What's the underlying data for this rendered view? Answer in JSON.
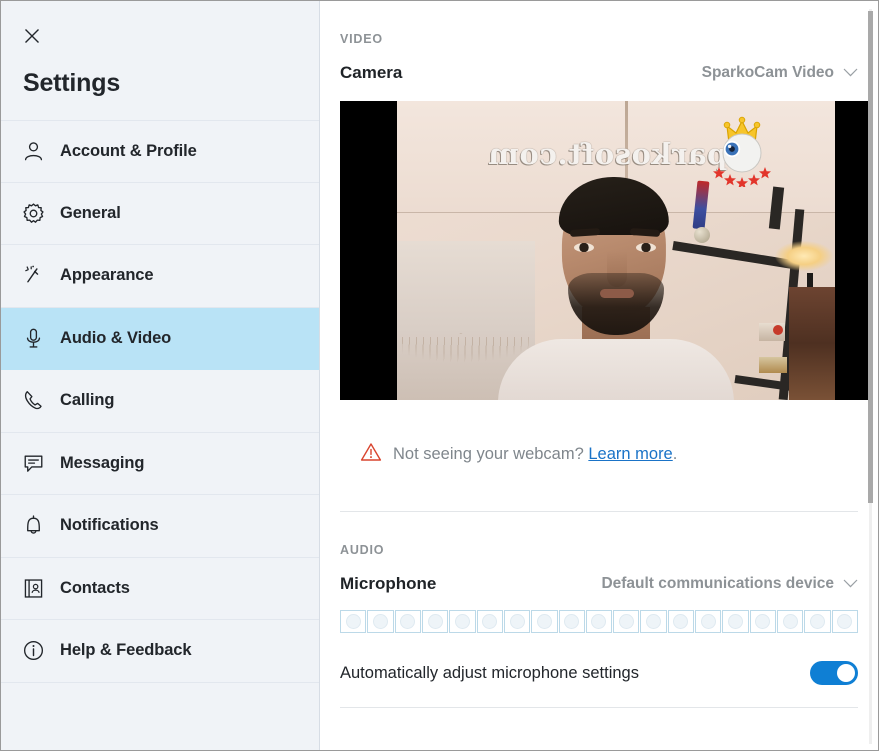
{
  "window": {
    "close_icon": "close-icon"
  },
  "sidebar": {
    "title": "Settings",
    "items": [
      {
        "label": "Account & Profile",
        "icon": "person-icon",
        "active": false
      },
      {
        "label": "General",
        "icon": "gear-icon",
        "active": false
      },
      {
        "label": "Appearance",
        "icon": "magic-wand-icon",
        "active": false
      },
      {
        "label": "Audio & Video",
        "icon": "microphone-icon",
        "active": true
      },
      {
        "label": "Calling",
        "icon": "phone-icon",
        "active": false
      },
      {
        "label": "Messaging",
        "icon": "chat-bubble-icon",
        "active": false
      },
      {
        "label": "Notifications",
        "icon": "bell-icon",
        "active": false
      },
      {
        "label": "Contacts",
        "icon": "address-book-icon",
        "active": false
      },
      {
        "label": "Help & Feedback",
        "icon": "info-circle-icon",
        "active": false
      }
    ]
  },
  "main": {
    "video": {
      "section_label": "VIDEO",
      "camera_label": "Camera",
      "camera_value": "SparkoCam Video",
      "chevron_icon": "chevron-down-icon",
      "preview": {
        "watermark": "sparkosoft.com",
        "overlay_icon": "crowned-eyeball-emoji"
      },
      "warning_icon": "warning-triangle-icon",
      "warning_text": "Not seeing your webcam?",
      "warning_link": "Learn more",
      "warning_suffix": "."
    },
    "audio": {
      "section_label": "AUDIO",
      "microphone_label": "Microphone",
      "microphone_value": "Default communications device",
      "chevron_icon": "chevron-down-icon",
      "meter_segments": 19,
      "auto_adjust_label": "Automatically adjust microphone settings",
      "auto_adjust_on": true
    }
  },
  "colors": {
    "accent_blue": "#0f7fd4",
    "selected_item_bg": "#b9e3f6",
    "sidebar_bg": "#f0f3f7",
    "link_blue": "#1a73c7",
    "warning_red": "#d9452f",
    "muted_text": "#8d9296"
  },
  "scrollbar": {
    "thumb_position_percent": 0
  }
}
